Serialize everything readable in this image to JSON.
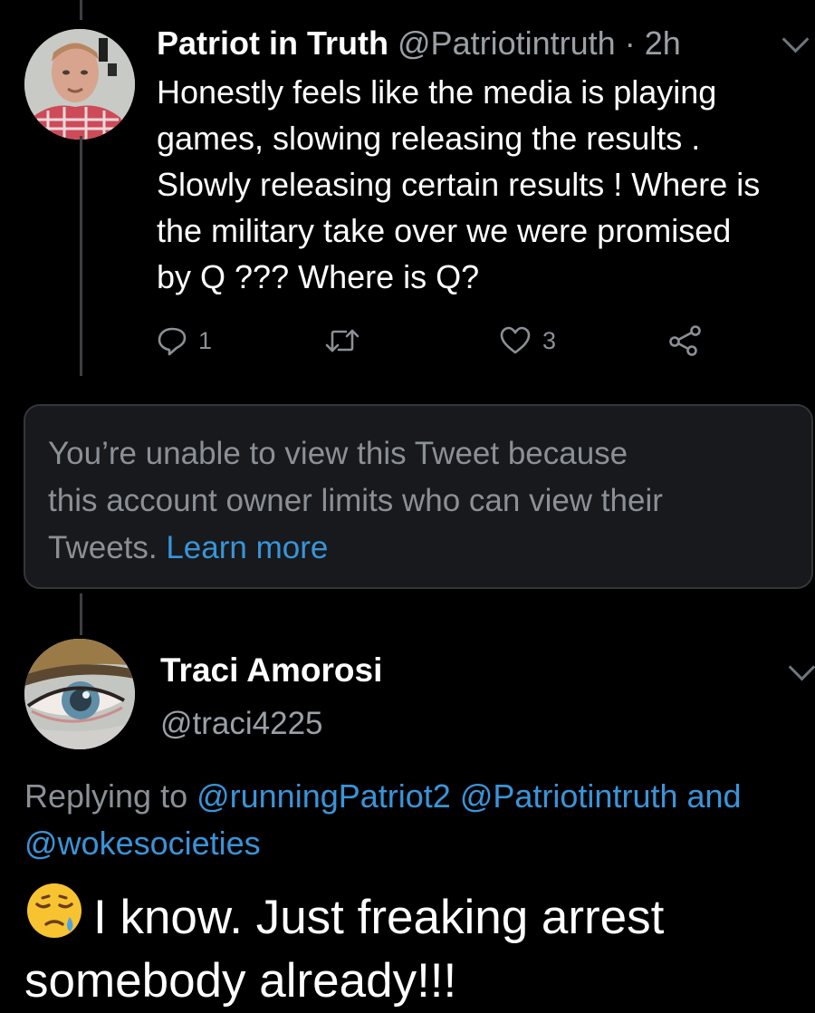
{
  "tweet1": {
    "name": "Patriot in Truth",
    "handle": "@Patriotintruth",
    "separator": "·",
    "time": "2h",
    "body_lines": [
      "Honestly feels like the media is playing",
      "games,  slowing releasing the results .",
      "Slowly releasing certain results ! Where is",
      "the military take over we were promised",
      "by Q ??? Where is Q?"
    ],
    "reply_count": "1",
    "like_count": "3"
  },
  "notice": {
    "lines": [
      "You’re unable to view this Tweet because",
      "this account owner limits who can view their"
    ],
    "last_line_prefix": "Tweets. ",
    "link_label": "Learn more"
  },
  "tweet2": {
    "name": "Traci Amorosi",
    "handle": "@traci4225",
    "replying_prefix": "Replying to ",
    "mention1": "@runningPatriot2",
    "mention2": "@Patriotintruth",
    "mention_joiner": " and",
    "mention3": "@wokesocieties",
    "body_line1": "I know. Just freaking arrest",
    "body_line2": "somebody already!!!"
  },
  "colors": {
    "background": "#000000",
    "link": "#3a94d8",
    "secondary_text": "#8b9096",
    "primary_text": "#ffffff"
  },
  "icons": {
    "reply": "reply-icon",
    "retweet": "retweet-icon",
    "like": "heart-icon",
    "share": "share-icon",
    "menu": "chevron-down-icon",
    "emoji": "sad-relieved-face-icon"
  }
}
